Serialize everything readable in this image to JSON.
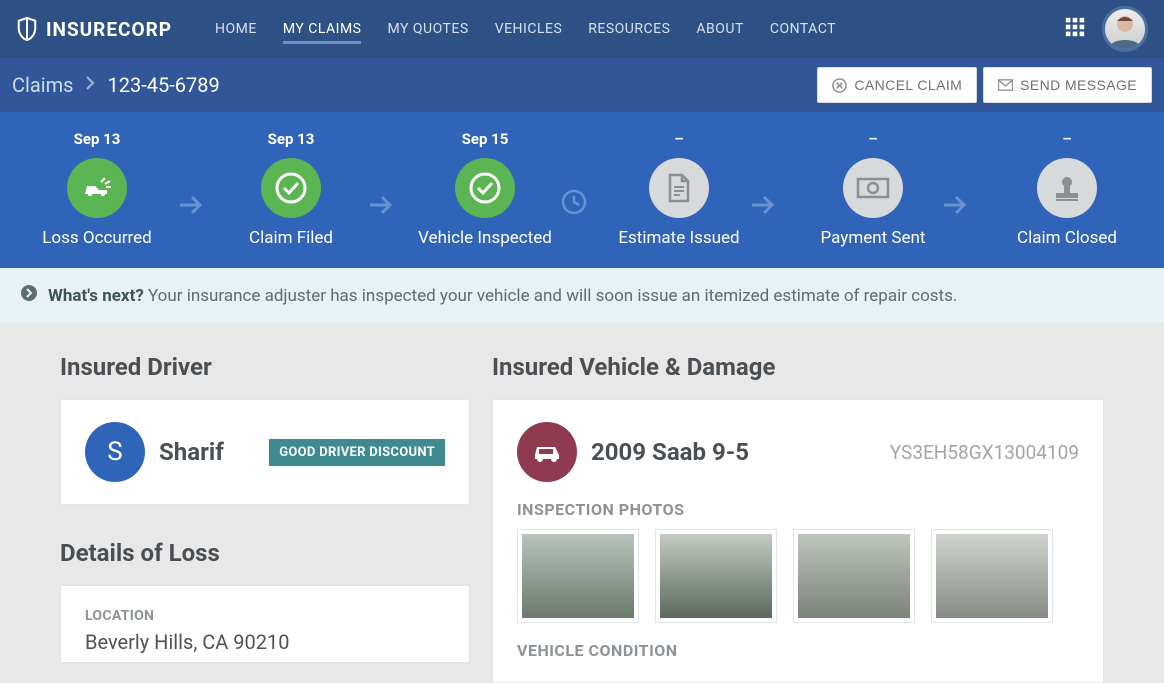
{
  "brand": "INSURECORP",
  "nav": {
    "home": "HOME",
    "claims": "MY CLAIMS",
    "quotes": "MY QUOTES",
    "vehicles": "VEHICLES",
    "resources": "RESOURCES",
    "about": "ABOUT",
    "contact": "CONTACT"
  },
  "breadcrumb": {
    "root": "Claims",
    "current": "123-45-6789"
  },
  "actions": {
    "cancel": "CANCEL CLAIM",
    "message": "SEND MESSAGE"
  },
  "timeline": [
    {
      "date": "Sep 13",
      "label": "Loss Occurred",
      "status": "done",
      "icon": "crash"
    },
    {
      "date": "Sep 13",
      "label": "Claim Filed",
      "status": "done",
      "icon": "check"
    },
    {
      "date": "Sep 15",
      "label": "Vehicle Inspected",
      "status": "done",
      "icon": "check"
    },
    {
      "date": "–",
      "label": "Estimate Issued",
      "status": "pending",
      "icon": "doc"
    },
    {
      "date": "–",
      "label": "Payment Sent",
      "status": "pending",
      "icon": "cash"
    },
    {
      "date": "–",
      "label": "Claim Closed",
      "status": "pending",
      "icon": "stamp"
    }
  ],
  "notice": {
    "lead": "What's next?",
    "body": "Your insurance adjuster has inspected your vehicle and will soon issue an itemized estimate of repair costs."
  },
  "driver_section_title": "Insured Driver",
  "driver": {
    "initial": "S",
    "name": "Sharif",
    "badge": "GOOD DRIVER DISCOUNT"
  },
  "loss_section_title": "Details of Loss",
  "loss": {
    "location_label": "LOCATION",
    "location": "Beverly Hills, CA 90210"
  },
  "vehicle_section_title": "Insured Vehicle & Damage",
  "vehicle": {
    "name": "2009 Saab 9-5",
    "vin": "YS3EH58GX13004109"
  },
  "inspection_label": "INSPECTION PHOTOS",
  "condition_label": "VEHICLE CONDITION"
}
